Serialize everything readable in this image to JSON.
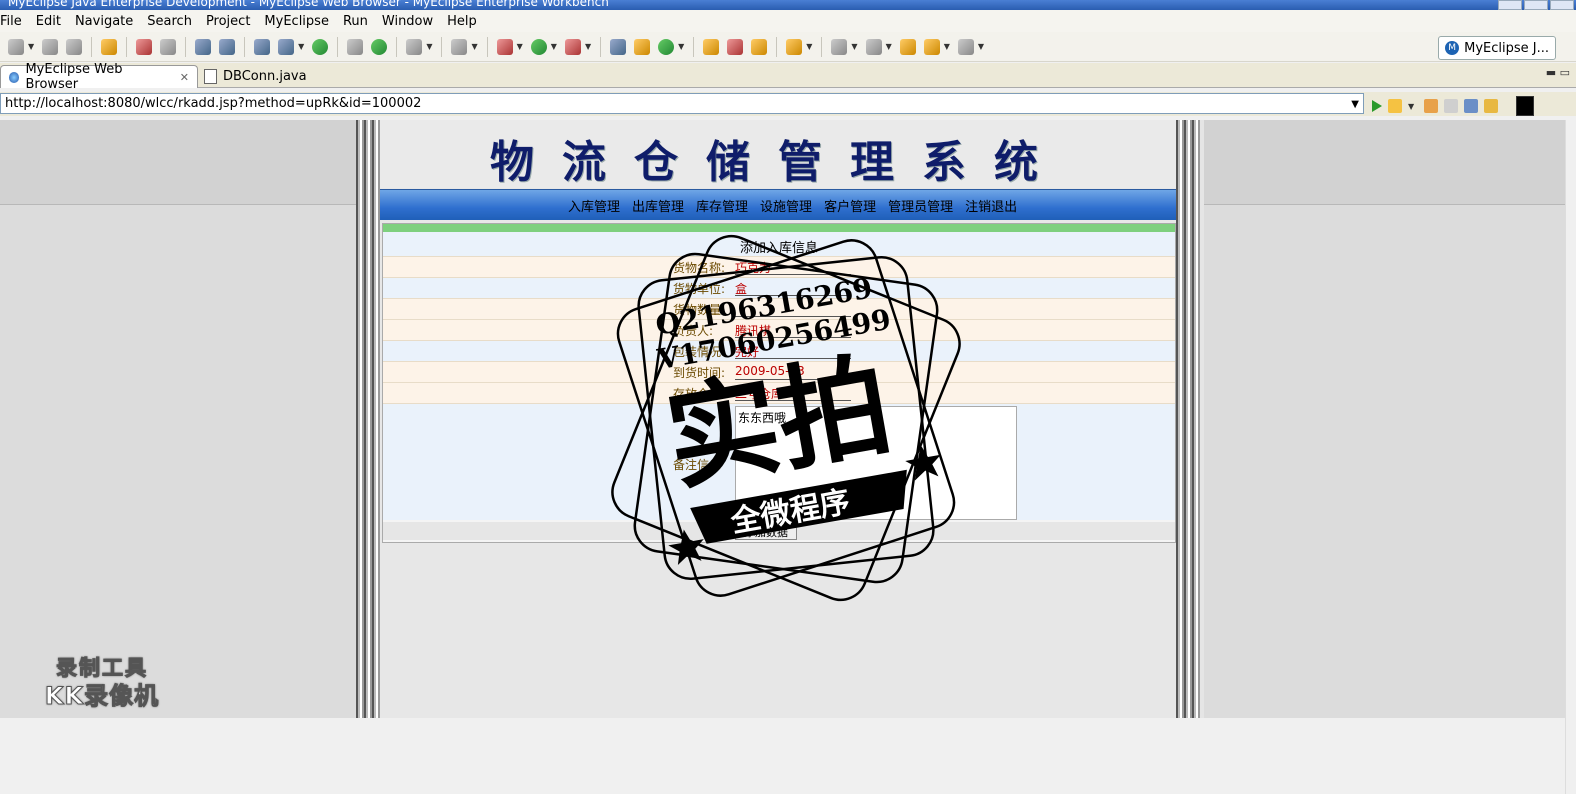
{
  "window": {
    "title": "MyEclipse Java Enterprise Development - MyEclipse Web Browser - MyEclipse Enterprise Workbench"
  },
  "menu": [
    "File",
    "Edit",
    "Navigate",
    "Search",
    "Project",
    "MyEclipse",
    "Run",
    "Window",
    "Help"
  ],
  "perspective": {
    "label": "MyEclipse J..."
  },
  "tabs": {
    "active": "MyEclipse Web Browser",
    "other": "DBConn.java"
  },
  "browser": {
    "url": "http://localhost:8080/wlcc/rkadd.jsp?method=upRk&id=100002"
  },
  "page": {
    "title": "物流仓储管理系统",
    "nav": [
      "入库管理",
      "出库管理",
      "库存管理",
      "设施管理",
      "客户管理",
      "管理员管理",
      "注销退出"
    ],
    "form": {
      "heading": "添加入库信息",
      "rows": [
        {
          "label": "货物名称:",
          "value": "巧克力"
        },
        {
          "label": "货物单位:",
          "value": "盒"
        },
        {
          "label": "货物数量:",
          "value": ""
        },
        {
          "label": "负责人:",
          "value": "腾讯棋"
        },
        {
          "label": "包装情况:",
          "value": "完好"
        },
        {
          "label": "到货时间:",
          "value": "2009-05-23"
        },
        {
          "label": "存放仓库:",
          "value": "二号仓库"
        }
      ],
      "notes_label": "备注信息",
      "notes_value": "东东西哦",
      "submit_label": "添加数据"
    }
  },
  "watermark": {
    "stamp_big": "实拍",
    "stamp_ribbon": "全微程序",
    "stamp_qq": "Q2196316269",
    "stamp_v": "V17060256499",
    "recorder_line1": "录制工具",
    "recorder_line2": "KK录像机"
  }
}
